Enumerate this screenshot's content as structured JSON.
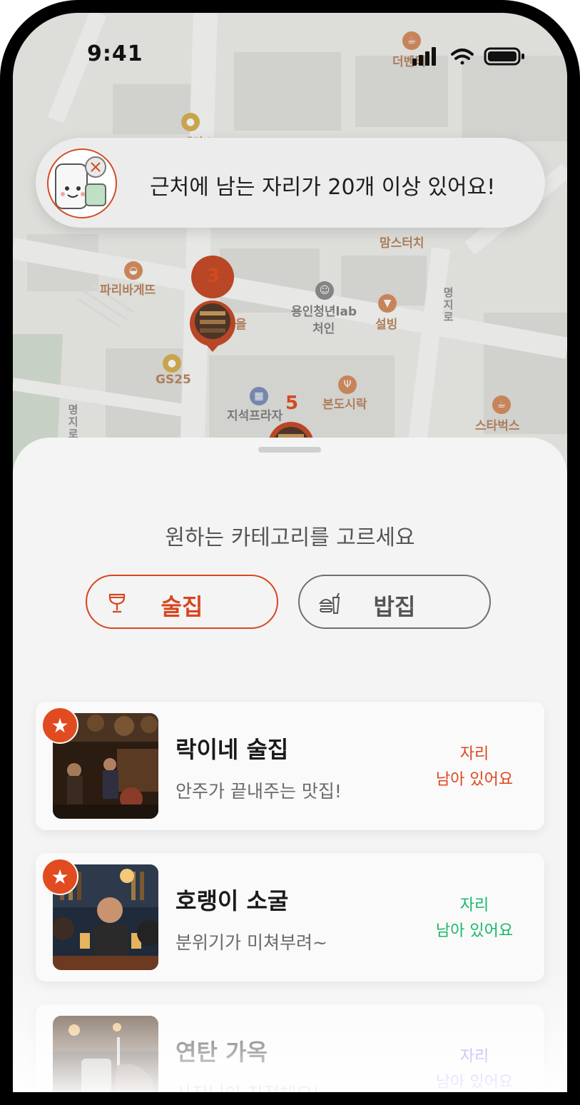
{
  "status_bar": {
    "time": "9:41"
  },
  "map": {
    "labels": {
      "deventi": "더벤티",
      "yd": "YD테라스",
      "momstouch": "맘스터치",
      "paris": "파리바게뜨",
      "youth_lab_1": "용인청년lab",
      "youth_lab_2": "처인",
      "sulbing": "설빙",
      "street_1": "명지로",
      "street_2": "명지로",
      "gs25": "GS25",
      "jisik": "지석프라자",
      "bondo": "본도시락",
      "starbucks": "스타벅스",
      "eul": "을"
    },
    "pins": [
      {
        "number": "3"
      },
      {
        "number": "5"
      }
    ]
  },
  "banner": {
    "text": "근처에 남는 자리가 20개 이상 있어요!"
  },
  "sheet": {
    "title": "원하는 카테고리를 고르세요",
    "categories": [
      {
        "label": "술집",
        "icon": "wine-glass-icon",
        "selected": true
      },
      {
        "label": "밥집",
        "icon": "burger-drink-icon",
        "selected": false
      }
    ],
    "restaurants": [
      {
        "name": "락이네 술집",
        "description": "안주가 끝내주는 맛집!",
        "status": "자리\n남아 있어요",
        "status_color": "#e0461c",
        "favorite": true
      },
      {
        "name": "호랭이 소굴",
        "description": "분위기가 미쳐부려~",
        "status": "자리\n남아 있어요",
        "status_color": "#19b86a",
        "favorite": true
      },
      {
        "name": "연탄 가옥",
        "description": "사장님이 친절해요!",
        "status": "자리\n남아 있어요",
        "status_color": "#6a5cf0",
        "favorite": false
      }
    ]
  },
  "colors": {
    "accent": "#d8461f",
    "green": "#19b86a",
    "purple": "#6a5cf0"
  }
}
